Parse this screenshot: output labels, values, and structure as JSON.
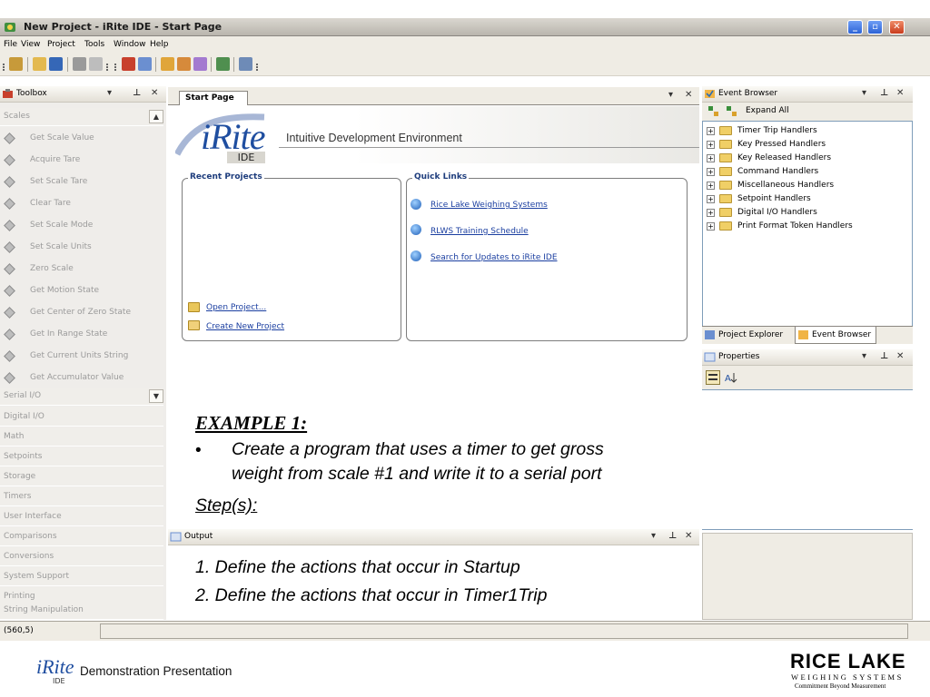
{
  "window": {
    "title": "New Project - iRite IDE - Start Page"
  },
  "menu": [
    "File",
    "View",
    "Project",
    "Tools",
    "Window",
    "Help"
  ],
  "toolbox": {
    "title": "Toolbox",
    "group_open": "Scales",
    "items": [
      "Get Scale Value",
      "Acquire Tare",
      "Set Scale Tare",
      "Clear Tare",
      "Set Scale Mode",
      "Set Scale Units",
      "Zero Scale",
      "Get Motion State",
      "Get Center of Zero State",
      "Get In Range State",
      "Get Current Units String",
      "Get Accumulator Value"
    ],
    "group_serial": "Serial I/O",
    "categories": [
      "Digital I/O",
      "Math",
      "Setpoints",
      "Storage",
      "Timers",
      "User Interface",
      "Comparisons",
      "Conversions",
      "System Support",
      "Printing",
      "String Manipulation"
    ]
  },
  "start_page": {
    "tab": "Start Page",
    "logo": "iRite",
    "logo_sub": "IDE",
    "tagline": "Intuitive Development Environment",
    "recent": {
      "title": "Recent Projects",
      "open": "Open Project...",
      "create": "Create New Project"
    },
    "quick_links": {
      "title": "Quick Links",
      "links": [
        "Rice Lake Weighing Systems",
        "RLWS Training Schedule",
        "Search for Updates to iRite IDE"
      ]
    }
  },
  "event_browser": {
    "title": "Event Browser",
    "expand_all": "Expand All",
    "handlers": [
      "Timer Trip Handlers",
      "Key Pressed Handlers",
      "Key Released Handlers",
      "Command Handlers",
      "Miscellaneous Handlers",
      "Setpoint Handlers",
      "Digital I/O Handlers",
      "Print Format Token Handlers"
    ],
    "tabs": [
      "Project Explorer",
      "Event Browser"
    ]
  },
  "properties": {
    "title": "Properties"
  },
  "output": {
    "title": "Output"
  },
  "status": {
    "coords": "(560,5)"
  },
  "slide": {
    "heading": "EXAMPLE 1:",
    "bullet": "•",
    "line1": "Create a program that uses a timer to get gross",
    "line2": "weight from scale #1 and write it to a serial port",
    "steps_label": "Step(s):",
    "step1": "1.  Define the actions that occur in Startup",
    "step2": "2.  Define the actions that occur in Timer1Trip"
  },
  "footer": {
    "logo": "iRite",
    "logo_sub": "IDE",
    "text": "Demonstration Presentation",
    "brand": "RICE LAKE",
    "brand_sub": "WEIGHING SYSTEMS",
    "brand_tag": "Commitment Beyond Measurement"
  }
}
